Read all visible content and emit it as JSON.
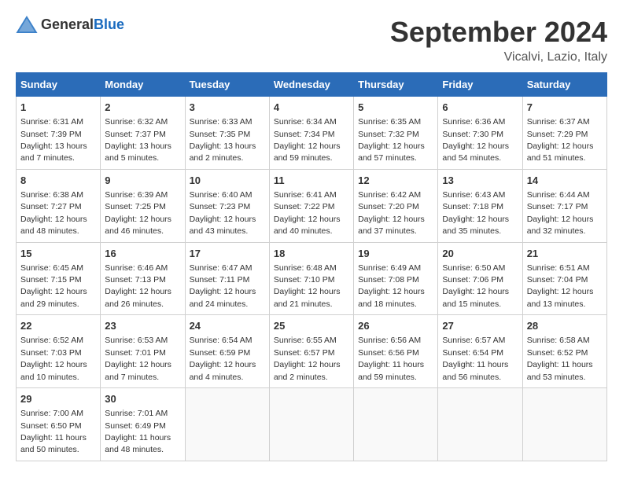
{
  "header": {
    "logo_general": "General",
    "logo_blue": "Blue",
    "title": "September 2024",
    "location": "Vicalvi, Lazio, Italy"
  },
  "columns": [
    "Sunday",
    "Monday",
    "Tuesday",
    "Wednesday",
    "Thursday",
    "Friday",
    "Saturday"
  ],
  "weeks": [
    [
      {
        "day": "1",
        "sunrise": "Sunrise: 6:31 AM",
        "sunset": "Sunset: 7:39 PM",
        "daylight": "Daylight: 13 hours and 7 minutes."
      },
      {
        "day": "2",
        "sunrise": "Sunrise: 6:32 AM",
        "sunset": "Sunset: 7:37 PM",
        "daylight": "Daylight: 13 hours and 5 minutes."
      },
      {
        "day": "3",
        "sunrise": "Sunrise: 6:33 AM",
        "sunset": "Sunset: 7:35 PM",
        "daylight": "Daylight: 13 hours and 2 minutes."
      },
      {
        "day": "4",
        "sunrise": "Sunrise: 6:34 AM",
        "sunset": "Sunset: 7:34 PM",
        "daylight": "Daylight: 12 hours and 59 minutes."
      },
      {
        "day": "5",
        "sunrise": "Sunrise: 6:35 AM",
        "sunset": "Sunset: 7:32 PM",
        "daylight": "Daylight: 12 hours and 57 minutes."
      },
      {
        "day": "6",
        "sunrise": "Sunrise: 6:36 AM",
        "sunset": "Sunset: 7:30 PM",
        "daylight": "Daylight: 12 hours and 54 minutes."
      },
      {
        "day": "7",
        "sunrise": "Sunrise: 6:37 AM",
        "sunset": "Sunset: 7:29 PM",
        "daylight": "Daylight: 12 hours and 51 minutes."
      }
    ],
    [
      {
        "day": "8",
        "sunrise": "Sunrise: 6:38 AM",
        "sunset": "Sunset: 7:27 PM",
        "daylight": "Daylight: 12 hours and 48 minutes."
      },
      {
        "day": "9",
        "sunrise": "Sunrise: 6:39 AM",
        "sunset": "Sunset: 7:25 PM",
        "daylight": "Daylight: 12 hours and 46 minutes."
      },
      {
        "day": "10",
        "sunrise": "Sunrise: 6:40 AM",
        "sunset": "Sunset: 7:23 PM",
        "daylight": "Daylight: 12 hours and 43 minutes."
      },
      {
        "day": "11",
        "sunrise": "Sunrise: 6:41 AM",
        "sunset": "Sunset: 7:22 PM",
        "daylight": "Daylight: 12 hours and 40 minutes."
      },
      {
        "day": "12",
        "sunrise": "Sunrise: 6:42 AM",
        "sunset": "Sunset: 7:20 PM",
        "daylight": "Daylight: 12 hours and 37 minutes."
      },
      {
        "day": "13",
        "sunrise": "Sunrise: 6:43 AM",
        "sunset": "Sunset: 7:18 PM",
        "daylight": "Daylight: 12 hours and 35 minutes."
      },
      {
        "day": "14",
        "sunrise": "Sunrise: 6:44 AM",
        "sunset": "Sunset: 7:17 PM",
        "daylight": "Daylight: 12 hours and 32 minutes."
      }
    ],
    [
      {
        "day": "15",
        "sunrise": "Sunrise: 6:45 AM",
        "sunset": "Sunset: 7:15 PM",
        "daylight": "Daylight: 12 hours and 29 minutes."
      },
      {
        "day": "16",
        "sunrise": "Sunrise: 6:46 AM",
        "sunset": "Sunset: 7:13 PM",
        "daylight": "Daylight: 12 hours and 26 minutes."
      },
      {
        "day": "17",
        "sunrise": "Sunrise: 6:47 AM",
        "sunset": "Sunset: 7:11 PM",
        "daylight": "Daylight: 12 hours and 24 minutes."
      },
      {
        "day": "18",
        "sunrise": "Sunrise: 6:48 AM",
        "sunset": "Sunset: 7:10 PM",
        "daylight": "Daylight: 12 hours and 21 minutes."
      },
      {
        "day": "19",
        "sunrise": "Sunrise: 6:49 AM",
        "sunset": "Sunset: 7:08 PM",
        "daylight": "Daylight: 12 hours and 18 minutes."
      },
      {
        "day": "20",
        "sunrise": "Sunrise: 6:50 AM",
        "sunset": "Sunset: 7:06 PM",
        "daylight": "Daylight: 12 hours and 15 minutes."
      },
      {
        "day": "21",
        "sunrise": "Sunrise: 6:51 AM",
        "sunset": "Sunset: 7:04 PM",
        "daylight": "Daylight: 12 hours and 13 minutes."
      }
    ],
    [
      {
        "day": "22",
        "sunrise": "Sunrise: 6:52 AM",
        "sunset": "Sunset: 7:03 PM",
        "daylight": "Daylight: 12 hours and 10 minutes."
      },
      {
        "day": "23",
        "sunrise": "Sunrise: 6:53 AM",
        "sunset": "Sunset: 7:01 PM",
        "daylight": "Daylight: 12 hours and 7 minutes."
      },
      {
        "day": "24",
        "sunrise": "Sunrise: 6:54 AM",
        "sunset": "Sunset: 6:59 PM",
        "daylight": "Daylight: 12 hours and 4 minutes."
      },
      {
        "day": "25",
        "sunrise": "Sunrise: 6:55 AM",
        "sunset": "Sunset: 6:57 PM",
        "daylight": "Daylight: 12 hours and 2 minutes."
      },
      {
        "day": "26",
        "sunrise": "Sunrise: 6:56 AM",
        "sunset": "Sunset: 6:56 PM",
        "daylight": "Daylight: 11 hours and 59 minutes."
      },
      {
        "day": "27",
        "sunrise": "Sunrise: 6:57 AM",
        "sunset": "Sunset: 6:54 PM",
        "daylight": "Daylight: 11 hours and 56 minutes."
      },
      {
        "day": "28",
        "sunrise": "Sunrise: 6:58 AM",
        "sunset": "Sunset: 6:52 PM",
        "daylight": "Daylight: 11 hours and 53 minutes."
      }
    ],
    [
      {
        "day": "29",
        "sunrise": "Sunrise: 7:00 AM",
        "sunset": "Sunset: 6:50 PM",
        "daylight": "Daylight: 11 hours and 50 minutes."
      },
      {
        "day": "30",
        "sunrise": "Sunrise: 7:01 AM",
        "sunset": "Sunset: 6:49 PM",
        "daylight": "Daylight: 11 hours and 48 minutes."
      },
      null,
      null,
      null,
      null,
      null
    ]
  ]
}
